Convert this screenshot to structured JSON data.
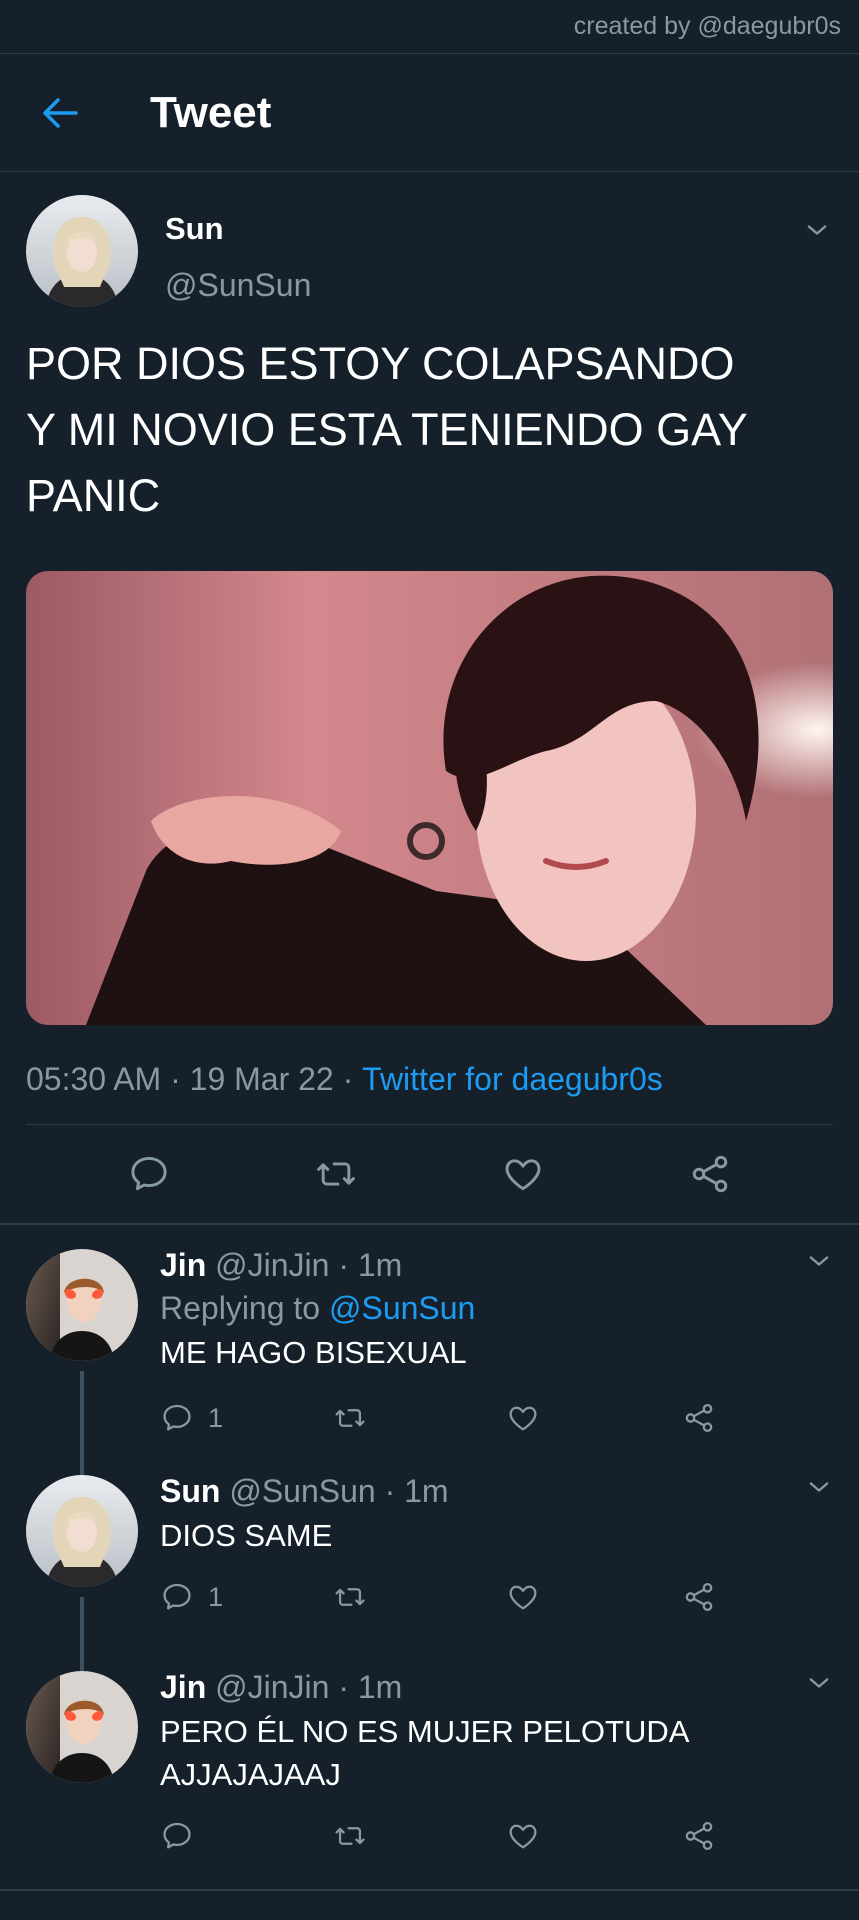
{
  "credit": "created by @daegubr0s",
  "header": {
    "title": "Tweet"
  },
  "main_tweet": {
    "name": "Sun",
    "handle": "@SunSun",
    "text": "POR DIOS ESTOY COLAPSANDO\nY MI NOVIO ESTA TENIENDO GAY\nPANIC",
    "time": "05:30 AM",
    "date": "19 Mar 22",
    "separator": " · ",
    "source": "Twitter for daegubr0s"
  },
  "replies": [
    {
      "name": "Jin",
      "handle": "@JinJin",
      "time": "· 1m",
      "replying_prefix": "Replying to ",
      "replying_to": "@SunSun",
      "text": "ME HAGO BISEXUAL",
      "comment_count": "1"
    },
    {
      "name": "Sun",
      "handle": "@SunSun",
      "time": "· 1m",
      "text": "DIOS SAME",
      "comment_count": "1"
    },
    {
      "name": "Jin",
      "handle": "@JinJin",
      "time": "· 1m",
      "text": "PERO ÉL NO ES MUJER PELOTUDA\nAJJAJAJAAJ",
      "comment_count": ""
    }
  ],
  "colors": {
    "background": "#15202b",
    "accent": "#1d9bf0",
    "muted": "#8899a6",
    "divider": "#2f3b47"
  }
}
